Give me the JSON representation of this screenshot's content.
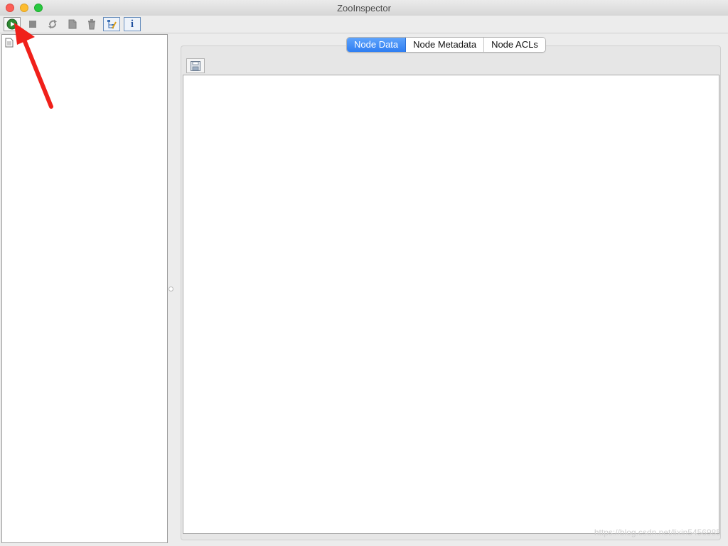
{
  "window": {
    "title": "ZooInspector"
  },
  "toolbar": {
    "buttons": [
      {
        "name": "connect",
        "icon": "play-icon"
      },
      {
        "name": "disconnect",
        "icon": "stop-icon"
      },
      {
        "name": "refresh",
        "icon": "refresh-icon"
      },
      {
        "name": "add-node",
        "icon": "add-node-icon"
      },
      {
        "name": "delete-node",
        "icon": "delete-icon"
      },
      {
        "name": "node-viewers",
        "icon": "tree-edit-icon"
      },
      {
        "name": "about",
        "icon": "info-icon"
      }
    ],
    "info_glyph": "i"
  },
  "tree": {
    "root_icon": "document-icon"
  },
  "tabs": [
    {
      "label": "Node Data",
      "active": true
    },
    {
      "label": "Node Metadata",
      "active": false
    },
    {
      "label": "Node ACLs",
      "active": false
    }
  ],
  "data_editor": {
    "save_icon": "floppy-disk-icon",
    "content": ""
  },
  "annotation": {
    "color": "#f0201a"
  },
  "watermark": "https://blog.csdn.net/lixin5456985",
  "colors": {
    "accent": "#2f7ef2",
    "arrow": "#f0201a"
  }
}
